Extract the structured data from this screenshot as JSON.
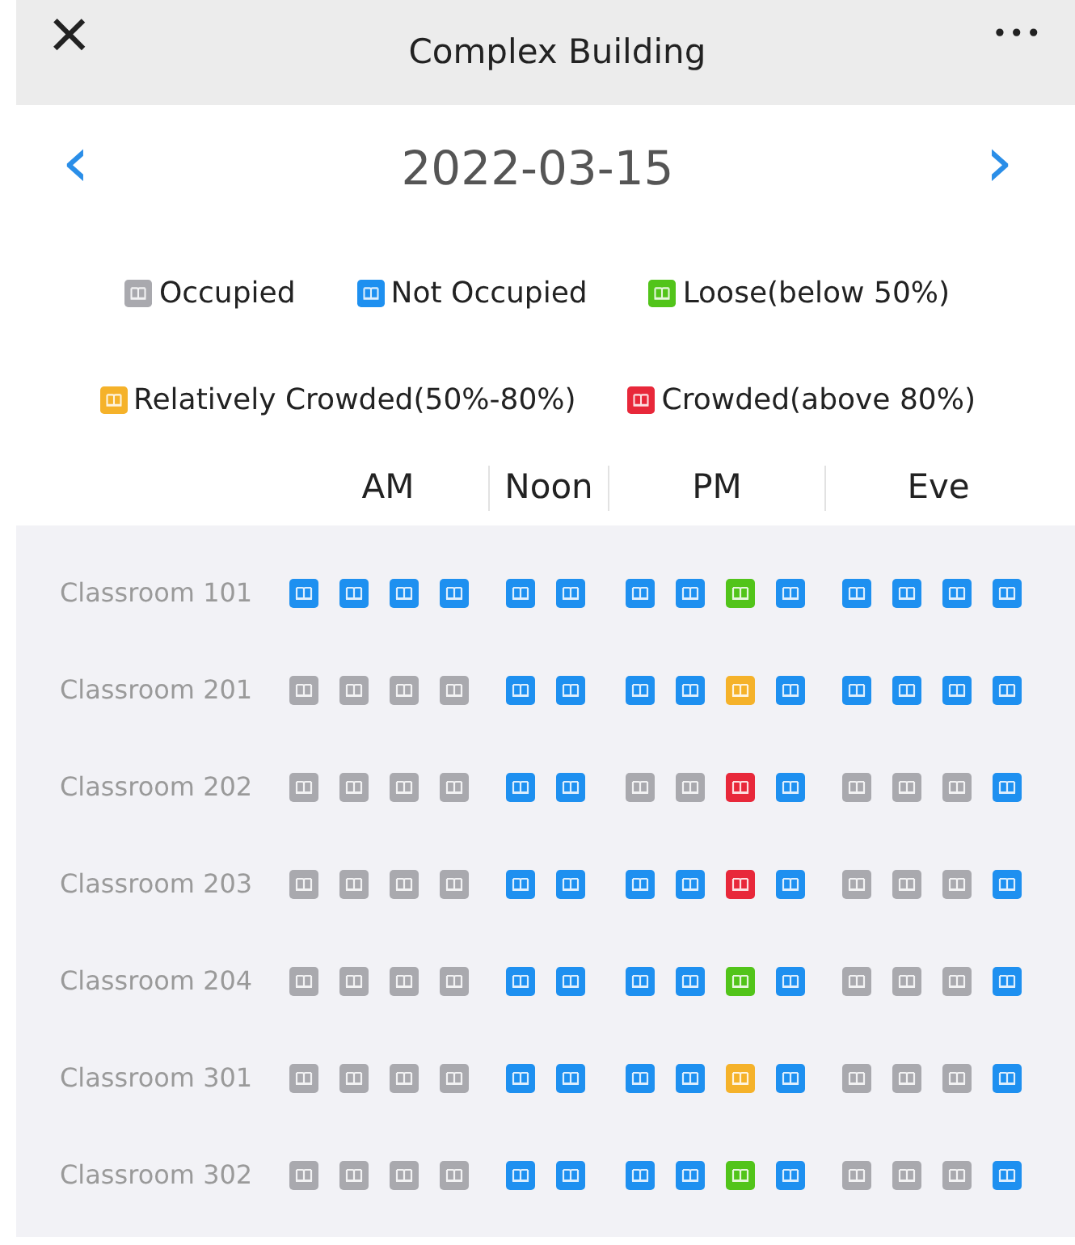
{
  "header": {
    "close": "×",
    "title": "Complex Building",
    "more": "•••"
  },
  "date_nav": {
    "prev": "‹",
    "date": "2022-03-15",
    "next": "›"
  },
  "legend": [
    {
      "label": "Occupied",
      "color": "#a9a9ae"
    },
    {
      "label": "Not Occupied",
      "color": "#1e90f0"
    },
    {
      "label": "Loose(below 50%)",
      "color": "#52c41a"
    },
    {
      "label": "Relatively Crowded(50%-80%)",
      "color": "#f5b22a"
    },
    {
      "label": "Crowded(above 80%)",
      "color": "#e8283a"
    }
  ],
  "periods": [
    "AM",
    "Noon",
    "PM",
    "Eve"
  ],
  "rooms": [
    {
      "name": "Classroom 101",
      "slots": [
        [
          {
            "color": "#1e90f0"
          },
          {
            "color": "#1e90f0"
          },
          {
            "color": "#1e90f0"
          },
          {
            "color": "#1e90f0"
          }
        ],
        [
          {
            "color": "#1e90f0"
          },
          {
            "color": "#1e90f0"
          }
        ],
        [
          {
            "color": "#1e90f0"
          },
          {
            "color": "#1e90f0"
          },
          {
            "color": "#52c41a"
          },
          {
            "color": "#1e90f0"
          }
        ],
        [
          {
            "color": "#1e90f0"
          },
          {
            "color": "#1e90f0"
          },
          {
            "color": "#1e90f0"
          },
          {
            "color": "#1e90f0"
          }
        ]
      ]
    },
    {
      "name": "Classroom 201",
      "slots": [
        [
          {
            "color": "#a9a9ae"
          },
          {
            "color": "#a9a9ae"
          },
          {
            "color": "#a9a9ae"
          },
          {
            "color": "#a9a9ae"
          }
        ],
        [
          {
            "color": "#1e90f0"
          },
          {
            "color": "#1e90f0"
          }
        ],
        [
          {
            "color": "#1e90f0"
          },
          {
            "color": "#1e90f0"
          },
          {
            "color": "#f5b22a"
          },
          {
            "color": "#1e90f0"
          }
        ],
        [
          {
            "color": "#1e90f0"
          },
          {
            "color": "#1e90f0"
          },
          {
            "color": "#1e90f0"
          },
          {
            "color": "#1e90f0"
          }
        ]
      ]
    },
    {
      "name": "Classroom 202",
      "slots": [
        [
          {
            "color": "#a9a9ae"
          },
          {
            "color": "#a9a9ae"
          },
          {
            "color": "#a9a9ae"
          },
          {
            "color": "#a9a9ae"
          }
        ],
        [
          {
            "color": "#1e90f0"
          },
          {
            "color": "#1e90f0"
          }
        ],
        [
          {
            "color": "#a9a9ae"
          },
          {
            "color": "#a9a9ae"
          },
          {
            "color": "#e8283a"
          },
          {
            "color": "#1e90f0"
          }
        ],
        [
          {
            "color": "#a9a9ae"
          },
          {
            "color": "#a9a9ae"
          },
          {
            "color": "#a9a9ae"
          },
          {
            "color": "#1e90f0"
          }
        ]
      ]
    },
    {
      "name": "Classroom 203",
      "slots": [
        [
          {
            "color": "#a9a9ae"
          },
          {
            "color": "#a9a9ae"
          },
          {
            "color": "#a9a9ae"
          },
          {
            "color": "#a9a9ae"
          }
        ],
        [
          {
            "color": "#1e90f0"
          },
          {
            "color": "#1e90f0"
          }
        ],
        [
          {
            "color": "#1e90f0"
          },
          {
            "color": "#1e90f0"
          },
          {
            "color": "#e8283a"
          },
          {
            "color": "#1e90f0"
          }
        ],
        [
          {
            "color": "#a9a9ae"
          },
          {
            "color": "#a9a9ae"
          },
          {
            "color": "#a9a9ae"
          },
          {
            "color": "#1e90f0"
          }
        ]
      ]
    },
    {
      "name": "Classroom 204",
      "slots": [
        [
          {
            "color": "#a9a9ae"
          },
          {
            "color": "#a9a9ae"
          },
          {
            "color": "#a9a9ae"
          },
          {
            "color": "#a9a9ae"
          }
        ],
        [
          {
            "color": "#1e90f0"
          },
          {
            "color": "#1e90f0"
          }
        ],
        [
          {
            "color": "#1e90f0"
          },
          {
            "color": "#1e90f0"
          },
          {
            "color": "#52c41a"
          },
          {
            "color": "#1e90f0"
          }
        ],
        [
          {
            "color": "#a9a9ae"
          },
          {
            "color": "#a9a9ae"
          },
          {
            "color": "#a9a9ae"
          },
          {
            "color": "#1e90f0"
          }
        ]
      ]
    },
    {
      "name": "Classroom 301",
      "slots": [
        [
          {
            "color": "#a9a9ae"
          },
          {
            "color": "#a9a9ae"
          },
          {
            "color": "#a9a9ae"
          },
          {
            "color": "#a9a9ae"
          }
        ],
        [
          {
            "color": "#1e90f0"
          },
          {
            "color": "#1e90f0"
          }
        ],
        [
          {
            "color": "#1e90f0"
          },
          {
            "color": "#1e90f0"
          },
          {
            "color": "#f5b22a"
          },
          {
            "color": "#1e90f0"
          }
        ],
        [
          {
            "color": "#a9a9ae"
          },
          {
            "color": "#a9a9ae"
          },
          {
            "color": "#a9a9ae"
          },
          {
            "color": "#1e90f0"
          }
        ]
      ]
    },
    {
      "name": "Classroom 302",
      "slots": [
        [
          {
            "color": "#a9a9ae"
          },
          {
            "color": "#a9a9ae"
          },
          {
            "color": "#a9a9ae"
          },
          {
            "color": "#a9a9ae"
          }
        ],
        [
          {
            "color": "#1e90f0"
          },
          {
            "color": "#1e90f0"
          }
        ],
        [
          {
            "color": "#1e90f0"
          },
          {
            "color": "#1e90f0"
          },
          {
            "color": "#52c41a"
          },
          {
            "color": "#1e90f0"
          }
        ],
        [
          {
            "color": "#a9a9ae"
          },
          {
            "color": "#a9a9ae"
          },
          {
            "color": "#a9a9ae"
          },
          {
            "color": "#1e90f0"
          }
        ]
      ]
    }
  ]
}
